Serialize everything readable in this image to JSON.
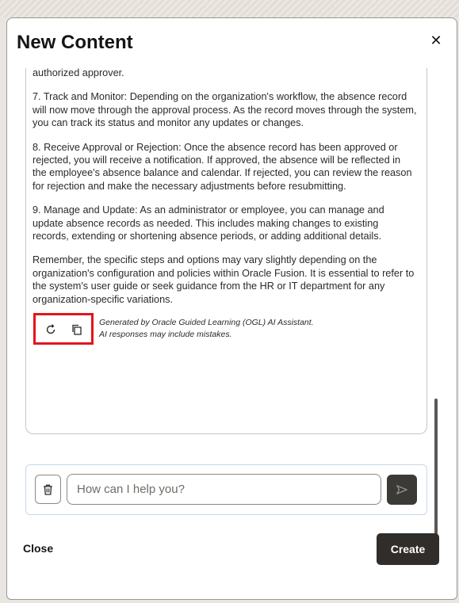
{
  "dialog": {
    "title": "New Content",
    "close_icon": "close-icon"
  },
  "content": {
    "paragraphs": [
      "authorized approver.",
      "7. Track and Monitor: Depending on the organization's workflow, the absence record will now move through the approval process. As the record moves through the system, you can track its status and monitor any updates or changes.",
      "8. Receive Approval or Rejection: Once the absence record has been approved or rejected, you will receive a notification. If approved, the absence will be reflected in the employee's absence balance and calendar. If rejected, you can review the reason for rejection and make the necessary adjustments before resubmitting.",
      "9. Manage and Update: As an administrator or employee, you can manage and update absence records as needed. This includes making changes to existing records, extending or shortening absence periods, or adding additional details.",
      "Remember, the specific steps and options may vary slightly depending on the organization's configuration and policies within Oracle Fusion. It is essential to refer to the system's user guide or seek guidance from the HR or IT department for any organization-specific variations."
    ],
    "disclaimer_line1": "Generated by Oracle Guided Learning (OGL) AI Assistant.",
    "disclaimer_line2": "AI responses may include mistakes.",
    "actions": {
      "regenerate_icon": "refresh-icon",
      "copy_icon": "copy-icon"
    },
    "highlight_color": "#e4141b"
  },
  "chat": {
    "placeholder": "How can I help you?",
    "trash_icon": "trash-icon",
    "send_icon": "send-icon"
  },
  "footer": {
    "close_label": "Close",
    "create_label": "Create"
  },
  "colors": {
    "primary_button": "#312d2a",
    "text": "#161513"
  }
}
